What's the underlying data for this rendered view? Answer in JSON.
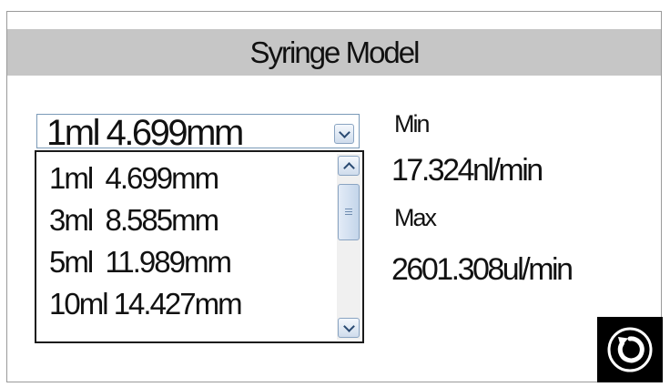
{
  "header": {
    "title": "Syringe Model"
  },
  "syringe_select": {
    "selected": "1ml 4.699mm",
    "options": [
      "1ml  4.699mm",
      "3ml  8.585mm",
      "5ml  11.989mm",
      "10ml 14.427mm"
    ]
  },
  "rates": {
    "min_label": "Min",
    "min_value": "17.324nl/min",
    "max_label": "Max",
    "max_value": "2601.308ul/min"
  },
  "icons": {
    "dropdown": "chevron-down-icon",
    "scroll_up": "chevron-up-icon",
    "scroll_down": "chevron-down-icon",
    "back": "return-icon"
  },
  "colors": {
    "title_bar": "#c6c6c6",
    "back_button": "#000000",
    "control_border": "#8aa4c2"
  }
}
